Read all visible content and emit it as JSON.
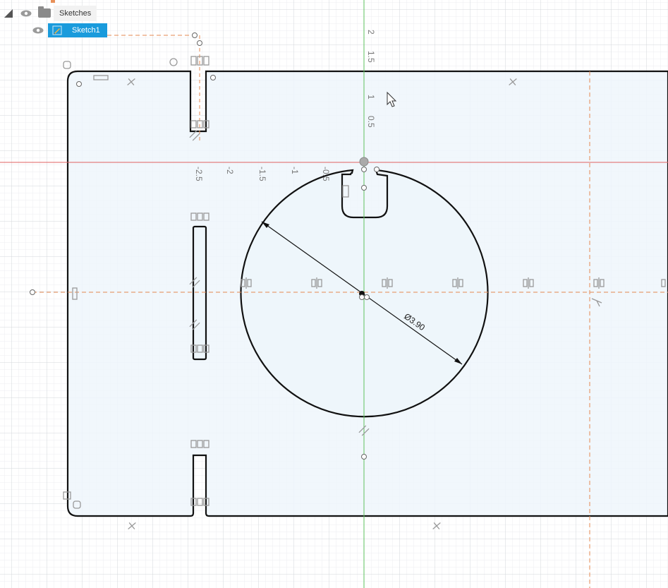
{
  "browser": {
    "folder_label": "Sketches",
    "sketch_label": "Sketch1",
    "icons": [
      "collapse-triangle-icon",
      "eye-icon",
      "folder-icon",
      "sketch-icon"
    ]
  },
  "axis": {
    "vertical_ticks": [
      "2",
      "1.5",
      "1",
      "0.5"
    ],
    "horizontal_ticks": [
      "-2.5",
      "-2",
      "-1.5",
      "-1",
      "-0.5"
    ]
  },
  "dimension": {
    "diameter_label": "Ø3.90"
  },
  "colors": {
    "profile_fill": "#eef6fb",
    "grid_major": "#d4d8dc",
    "grid_minor": "#eef0f2",
    "axis_red": "#e06060",
    "axis_green": "#5ec25e",
    "construction_orange": "#e58a52",
    "selection_blue": "#1a9bdc"
  }
}
